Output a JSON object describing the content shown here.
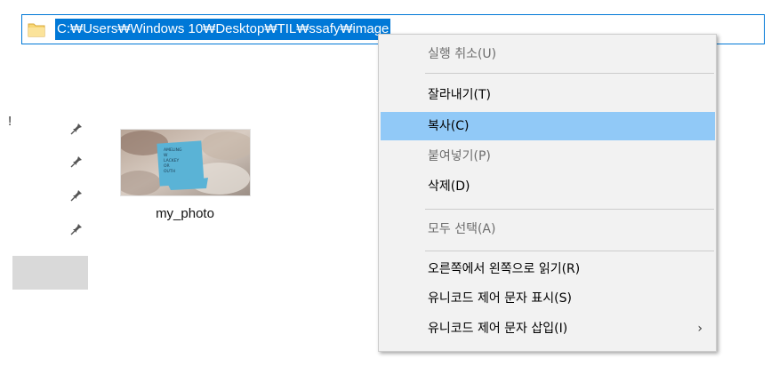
{
  "address_bar": {
    "path": "C:₩Users₩Windows 10₩Desktop₩TIL₩ssafy₩image"
  },
  "nav_pane": {
    "partial_text": "!",
    "pin_icon_count": 4
  },
  "file": {
    "name": "my_photo",
    "thumbnail_text": "AMELING\nW\nLACKEY\nOR\nOUTH"
  },
  "context_menu": {
    "items": [
      {
        "label": "실행 취소(U)",
        "enabled": false
      },
      {
        "label": "잘라내기(T)",
        "enabled": true
      },
      {
        "label": "복사(C)",
        "enabled": true,
        "highlighted": true
      },
      {
        "label": "붙여넣기(P)",
        "enabled": false
      },
      {
        "label": "삭제(D)",
        "enabled": true
      },
      {
        "label": "모두 선택(A)",
        "enabled": false
      },
      {
        "label": "오른쪽에서 왼쪽으로 읽기(R)",
        "enabled": true
      },
      {
        "label": "유니코드 제어 문자 표시(S)",
        "enabled": true
      },
      {
        "label": "유니코드 제어 문자 삽입(I)",
        "enabled": true,
        "submenu_arrow": "›"
      }
    ]
  },
  "colors": {
    "selection_blue": "#0078d7",
    "menu_highlight": "#91c9f7",
    "menu_background": "#f2f2f2",
    "folder_yellow": "#f8d775"
  }
}
